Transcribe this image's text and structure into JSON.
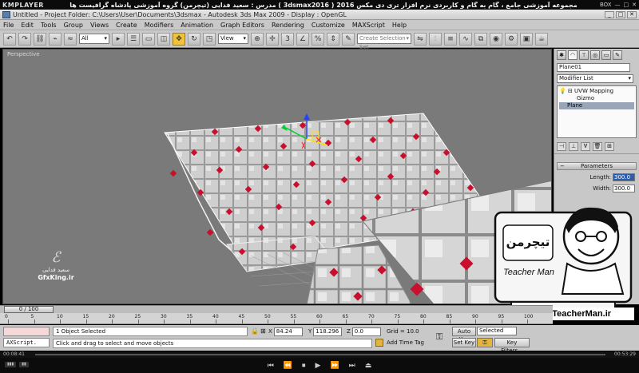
{
  "player": {
    "logo": "KMPLAYER",
    "title": "مجموعه آموزشی جامع ، گام به گام و کاربردی نرم افزار تری دی مکس 2016 ( 3dsmax2016 ) مدرس : سعید فدایی (تیچرمن) گروه آموزشی پادشاه گرافیست ها",
    "controls": [
      "BOX",
      "—",
      "□",
      "✕"
    ],
    "time_left": "00:08:41",
    "time_right": "00:53:29"
  },
  "window": {
    "title": "Untitled    - Project Folder: C:\\Users\\User\\Documents\\3dsmax    - Autodesk 3ds Max  2009         - Display : OpenGL"
  },
  "menu": [
    "File",
    "Edit",
    "Tools",
    "Group",
    "Views",
    "Create",
    "Modifiers",
    "Animation",
    "Graph Editors",
    "Rendering",
    "Customize",
    "MAXScript",
    "Help"
  ],
  "toolbar": {
    "filter_value": "All",
    "coord_system": "View",
    "selection_set_placeholder": "Create Selection Set"
  },
  "viewport": {
    "label": "Perspective"
  },
  "watermark": {
    "signature": "ℰ",
    "name": "سعید فدایی",
    "url": "GfxKing.ir"
  },
  "command_panel": {
    "object_name": "Plane01",
    "modifier_list": "Modifier List",
    "stack": [
      {
        "label": "UVW Mapping",
        "selected": false
      },
      {
        "label": "Gizmo",
        "selected": false
      },
      {
        "label": "Plane",
        "selected": true
      }
    ],
    "rollout_title": "Parameters",
    "length_label": "Length:",
    "length_value": "300.0",
    "width_label": "Width:",
    "width_value": "300.0"
  },
  "teacher": {
    "logo_text": "تیچرمن",
    "subtitle": "Teacher Man",
    "url": "www.TeacherMan.ir"
  },
  "timeline": {
    "thumb": "0 / 100",
    "ticks": [
      0,
      5,
      10,
      15,
      20,
      25,
      30,
      35,
      40,
      45,
      50,
      55,
      60,
      65,
      70,
      75,
      80,
      85,
      90,
      95,
      100
    ]
  },
  "status": {
    "maxscript_label": "AXScript.",
    "selected": "1 Object Selected",
    "prompt": "Click and drag to select and move objects",
    "x_label": "X",
    "x_value": "84.24",
    "y_label": "Y",
    "y_value": "118.296",
    "z_label": "Z",
    "z_value": "0.0",
    "grid": "Grid = 10.0",
    "add_time_tag": "Add Time Tag",
    "auto_key": "Auto Key",
    "set_key": "Set Key",
    "selected_dropdown": "Selected",
    "key_filters": "Key Filters..."
  },
  "colors": {
    "viewport_bg": "#7a7a7a",
    "tile_red": "#c8102e",
    "tile_gray": "#c9c9c9",
    "active_button": "#f1c23a"
  }
}
